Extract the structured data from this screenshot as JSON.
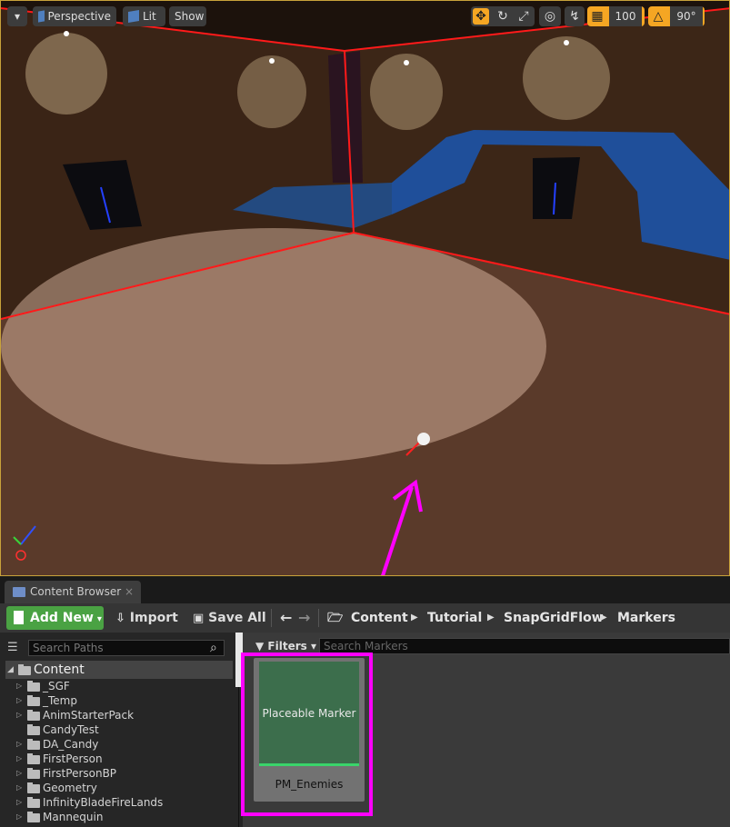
{
  "viewport": {
    "perspective_label": "Perspective",
    "lit_label": "Lit",
    "show_label": "Show",
    "grid_snap_value": "100",
    "rotation_snap_value": "90°",
    "colors": {
      "accent": "#f5a623",
      "wall_line": "#ff1a1a"
    }
  },
  "content_browser": {
    "tab_label": "Content Browser",
    "tab_close": "×",
    "toolbar": {
      "add_new_label": "Add New",
      "import_label": "Import",
      "save_all_label": "Save All"
    },
    "breadcrumb": [
      "Content",
      "Tutorial",
      "SnapGridFlow",
      "Markers"
    ],
    "paths_search_placeholder": "Search Paths",
    "filters_label": "Filters",
    "assets_search_placeholder": "Search Markers",
    "tree": {
      "root": "Content",
      "items": [
        {
          "label": "_SGF",
          "expandable": true
        },
        {
          "label": "_Temp",
          "expandable": true
        },
        {
          "label": "AnimStarterPack",
          "expandable": true
        },
        {
          "label": "CandyTest",
          "expandable": false
        },
        {
          "label": "DA_Candy",
          "expandable": true
        },
        {
          "label": "FirstPerson",
          "expandable": true
        },
        {
          "label": "FirstPersonBP",
          "expandable": true
        },
        {
          "label": "Geometry",
          "expandable": true
        },
        {
          "label": "InfinityBladeFireLands",
          "expandable": true
        },
        {
          "label": "Mannequin",
          "expandable": true
        }
      ]
    },
    "asset": {
      "thumbnail_label": "Placeable Marker",
      "name": "PM_Enemies"
    }
  },
  "highlight_color": "#ff00ff"
}
